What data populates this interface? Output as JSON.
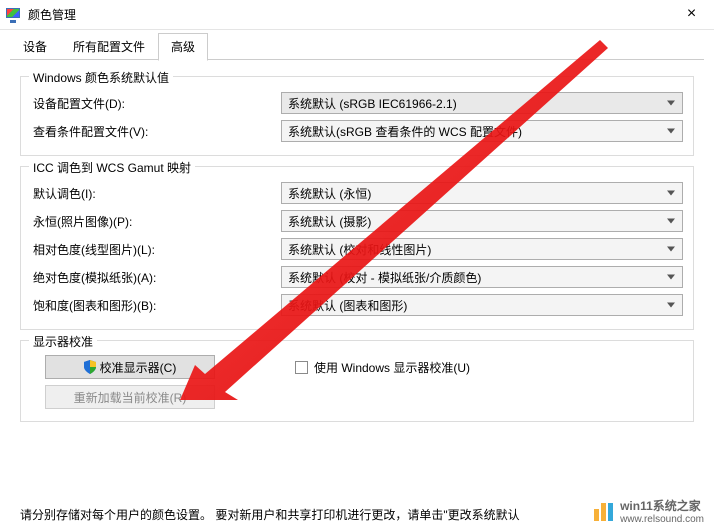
{
  "window": {
    "title": "颜色管理",
    "close": "×"
  },
  "tabs": {
    "devices": "设备",
    "profiles": "所有配置文件",
    "advanced": "高级"
  },
  "group_defaults": {
    "legend": "Windows 颜色系统默认值",
    "device_profile_label": "设备配置文件(D):",
    "device_profile_value": "系统默认 (sRGB IEC61966-2.1)",
    "viewing_profile_label": "查看条件配置文件(V):",
    "viewing_profile_value": "系统默认(sRGB 查看条件的 WCS 配置文件)"
  },
  "group_icc": {
    "legend": "ICC 调色到 WCS Gamut 映射",
    "default_intent_label": "默认调色(I):",
    "default_intent_value": "系统默认 (永恒)",
    "perceptual_label": "永恒(照片图像)(P):",
    "perceptual_value": "系统默认 (摄影)",
    "relative_label": "相对色度(线型图片)(L):",
    "relative_value": "系统默认 (校对和线性图片)",
    "absolute_label": "绝对色度(模拟纸张)(A):",
    "absolute_value": "系统默认 (校对 - 模拟纸张/介质颜色)",
    "saturation_label": "饱和度(图表和图形)(B):",
    "saturation_value": "系统默认 (图表和图形)"
  },
  "group_calib": {
    "legend": "显示器校准",
    "calibrate_btn": "校准显示器(C)",
    "reload_btn": "重新加载当前校准(R)",
    "use_win_calib": "使用 Windows 显示器校准(U)"
  },
  "footer": "请分别存储对每个用户的颜色设置。 要对新用户和共享打印机进行更改，请单击\"更改系统默认",
  "watermark": {
    "brand": "win11系统之家",
    "url": "www.relsound.com"
  }
}
